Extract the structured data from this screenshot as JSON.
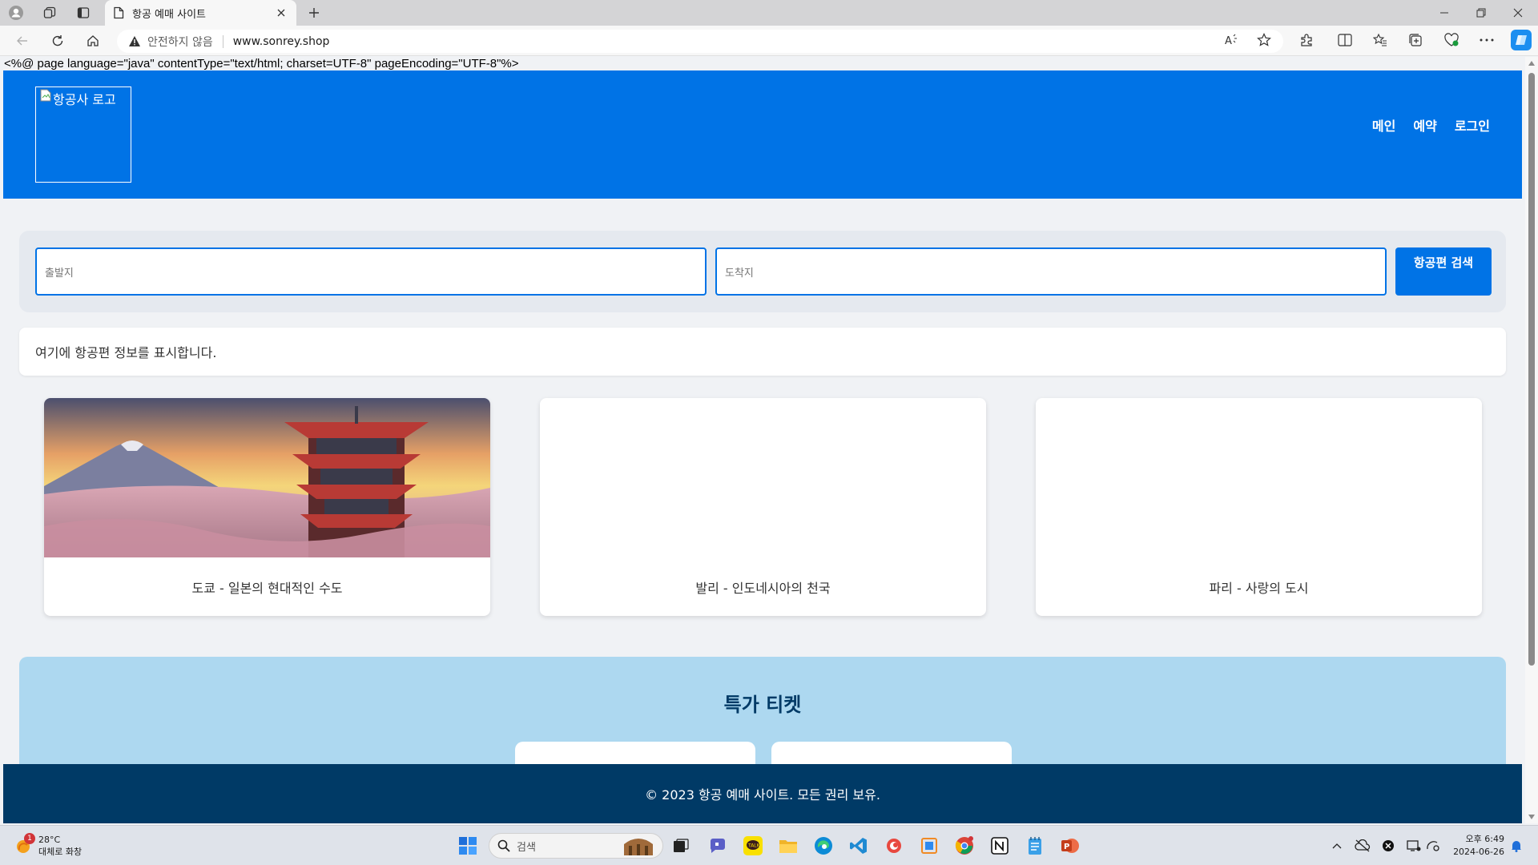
{
  "browser": {
    "tab_title": "항공 예매 사이트",
    "security_label": "안전하지 않음",
    "url": "www.sonrey.shop"
  },
  "page": {
    "raw_directive": "<%@ page language=\"java\" contentType=\"text/html; charset=UTF-8\" pageEncoding=\"UTF-8\"%>",
    "logo_alt": "항공사 로고",
    "nav": [
      "메인",
      "예약",
      "로그인"
    ],
    "search": {
      "origin_placeholder": "출발지",
      "destination_placeholder": "도착지",
      "button_label": "항공편 검색"
    },
    "flight_info": "여기에 항공편 정보를 표시합니다.",
    "destinations": [
      {
        "caption": "도쿄 - 일본의 현대적인 수도",
        "has_image": true
      },
      {
        "caption": "발리 - 인도네시아의 천국",
        "has_image": false
      },
      {
        "caption": "파리 - 사랑의 도시",
        "has_image": false
      }
    ],
    "deals_title": "특가 티켓",
    "footer": "© 2023 항공 예매 사이트. 모든 권리 보유."
  },
  "colors": {
    "primary": "#0073e6",
    "footer": "#003a66",
    "deals_bg": "#add8f0"
  },
  "taskbar": {
    "weather_temp": "28°C",
    "weather_desc": "대체로 화창",
    "weather_badge": "1",
    "search_placeholder": "검색",
    "time": "오후 6:49",
    "date": "2024-06-26"
  }
}
